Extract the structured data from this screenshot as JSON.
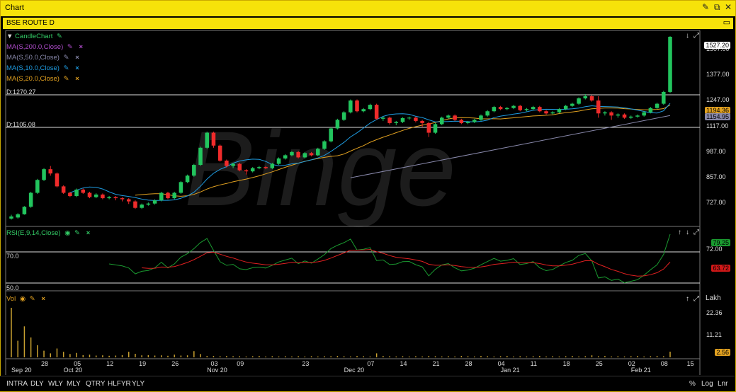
{
  "window": {
    "title": "Chart"
  },
  "panel": {
    "title": "BSE ROUTE D"
  },
  "watermark": "Binge",
  "indicators": [
    {
      "label": "CandleChart",
      "color": "#33cc66"
    },
    {
      "label": "MA(S,200.0,Close)",
      "color": "#b04ccc"
    },
    {
      "label": "MA(S,50.0,Close)",
      "color": "#8888aa"
    },
    {
      "label": "MA(S,10.0,Close)",
      "color": "#1e9be0"
    },
    {
      "label": "MA(S,20.0,Close)",
      "color": "#e0a020"
    }
  ],
  "hlines": {
    "upper_label": "D:1270.27",
    "lower_label": "D:1105.08"
  },
  "price_axis": {
    "ticks": [
      "1507.00",
      "1377.00",
      "1247.00",
      "1117.00",
      "987.00",
      "857.00",
      "727.00"
    ],
    "last_price": "1527.20",
    "ma_a": "1194.36",
    "ma_b": "1154.95"
  },
  "rsi": {
    "label": "RSI(E,9,14,Close)",
    "level_high": "70.0",
    "level_low": "50.0",
    "axis_tick": "72.00",
    "value_a": "79.25",
    "value_b": "63.72"
  },
  "volume": {
    "label": "Vol",
    "unit": "Lakh",
    "ticks": [
      "22.36",
      "11.21"
    ],
    "last": "2.56"
  },
  "date_axis": [
    {
      "d": "Sep 20",
      "p": 0
    },
    {
      "d": "28",
      "p": 5
    },
    {
      "d": "Oct 20",
      "p": 8
    },
    {
      "d": "05",
      "p": 10
    },
    {
      "d": "12",
      "p": 15
    },
    {
      "d": "19",
      "p": 20
    },
    {
      "d": "26",
      "p": 25
    },
    {
      "d": "Nov 20",
      "p": 30
    },
    {
      "d": "03",
      "p": 31
    },
    {
      "d": "09",
      "p": 35
    },
    {
      "d": "23",
      "p": 45
    },
    {
      "d": "Dec 20",
      "p": 51
    },
    {
      "d": "07",
      "p": 55
    },
    {
      "d": "14",
      "p": 60
    },
    {
      "d": "21",
      "p": 65
    },
    {
      "d": "28",
      "p": 70
    },
    {
      "d": "04",
      "p": 75
    },
    {
      "d": "Jan 21",
      "p": 75
    },
    {
      "d": "11",
      "p": 80
    },
    {
      "d": "18",
      "p": 85
    },
    {
      "d": "25",
      "p": 90
    },
    {
      "d": "02",
      "p": 95
    },
    {
      "d": "Feb 21",
      "p": 95
    },
    {
      "d": "08",
      "p": 100
    },
    {
      "d": "15",
      "p": 104
    }
  ],
  "timeframes": [
    "INTRA",
    "DLY",
    "WLY",
    "MLY",
    "QTRY",
    "HLFYR",
    "YLY"
  ],
  "right_buttons": [
    "%",
    "Log",
    "Lnr"
  ],
  "candles": [
    [
      680,
      690,
      675,
      698
    ],
    [
      685,
      700,
      680,
      705
    ],
    [
      700,
      735,
      698,
      738
    ],
    [
      735,
      800,
      730,
      805
    ],
    [
      800,
      860,
      795,
      865
    ],
    [
      860,
      910,
      855,
      915
    ],
    [
      910,
      890,
      880,
      925
    ],
    [
      890,
      830,
      825,
      895
    ],
    [
      830,
      800,
      795,
      835
    ],
    [
      800,
      785,
      780,
      805
    ],
    [
      785,
      815,
      780,
      820
    ],
    [
      815,
      800,
      795,
      820
    ],
    [
      800,
      780,
      775,
      805
    ],
    [
      780,
      792,
      775,
      798
    ],
    [
      792,
      775,
      770,
      797
    ],
    [
      775,
      780,
      770,
      785
    ],
    [
      780,
      775,
      765,
      785
    ],
    [
      775,
      770,
      760,
      780
    ],
    [
      770,
      760,
      748,
      775
    ],
    [
      760,
      730,
      725,
      765
    ],
    [
      730,
      745,
      725,
      750
    ],
    [
      745,
      750,
      740,
      755
    ],
    [
      750,
      765,
      745,
      770
    ],
    [
      765,
      800,
      760,
      805
    ],
    [
      800,
      775,
      770,
      805
    ],
    [
      775,
      800,
      770,
      805
    ],
    [
      800,
      850,
      795,
      855
    ],
    [
      850,
      880,
      845,
      885
    ],
    [
      880,
      930,
      875,
      935
    ],
    [
      930,
      1010,
      925,
      1015
    ],
    [
      1010,
      1080,
      1005,
      1085
    ],
    [
      1080,
      1020,
      1010,
      1085
    ],
    [
      1020,
      950,
      945,
      1025
    ],
    [
      950,
      925,
      918,
      955
    ],
    [
      925,
      935,
      915,
      940
    ],
    [
      935,
      905,
      900,
      940
    ],
    [
      905,
      900,
      885,
      910
    ],
    [
      900,
      915,
      895,
      920
    ],
    [
      915,
      920,
      910,
      925
    ],
    [
      920,
      915,
      910,
      925
    ],
    [
      915,
      935,
      910,
      940
    ],
    [
      935,
      960,
      930,
      965
    ],
    [
      960,
      975,
      955,
      980
    ],
    [
      975,
      990,
      970,
      995
    ],
    [
      990,
      965,
      960,
      995
    ],
    [
      965,
      985,
      960,
      990
    ],
    [
      985,
      975,
      970,
      990
    ],
    [
      975,
      1005,
      970,
      1010
    ],
    [
      1005,
      1040,
      1000,
      1045
    ],
    [
      1040,
      1100,
      1035,
      1105
    ],
    [
      1100,
      1140,
      1095,
      1145
    ],
    [
      1140,
      1175,
      1135,
      1180
    ],
    [
      1175,
      1230,
      1170,
      1235
    ],
    [
      1230,
      1180,
      1175,
      1235
    ],
    [
      1180,
      1190,
      1175,
      1195
    ],
    [
      1190,
      1210,
      1185,
      1215
    ],
    [
      1210,
      1145,
      1140,
      1215
    ],
    [
      1145,
      1150,
      1135,
      1155
    ],
    [
      1150,
      1125,
      1118,
      1155
    ],
    [
      1125,
      1130,
      1115,
      1135
    ],
    [
      1130,
      1148,
      1125,
      1152
    ],
    [
      1148,
      1150,
      1140,
      1155
    ],
    [
      1150,
      1135,
      1128,
      1155
    ],
    [
      1135,
      1125,
      1105,
      1140
    ],
    [
      1125,
      1080,
      1060,
      1130
    ],
    [
      1080,
      1120,
      1075,
      1125
    ],
    [
      1120,
      1150,
      1115,
      1155
    ],
    [
      1150,
      1160,
      1145,
      1165
    ],
    [
      1160,
      1140,
      1135,
      1165
    ],
    [
      1140,
      1125,
      1120,
      1145
    ],
    [
      1125,
      1130,
      1120,
      1135
    ],
    [
      1130,
      1140,
      1125,
      1145
    ],
    [
      1140,
      1160,
      1135,
      1165
    ],
    [
      1160,
      1180,
      1155,
      1185
    ],
    [
      1180,
      1200,
      1175,
      1205
    ],
    [
      1200,
      1190,
      1185,
      1205
    ],
    [
      1190,
      1195,
      1185,
      1200
    ],
    [
      1195,
      1205,
      1190,
      1210
    ],
    [
      1205,
      1185,
      1180,
      1210
    ],
    [
      1185,
      1190,
      1180,
      1195
    ],
    [
      1190,
      1200,
      1185,
      1205
    ],
    [
      1200,
      1180,
      1175,
      1205
    ],
    [
      1180,
      1170,
      1165,
      1185
    ],
    [
      1170,
      1175,
      1165,
      1180
    ],
    [
      1175,
      1190,
      1170,
      1195
    ],
    [
      1190,
      1205,
      1185,
      1210
    ],
    [
      1205,
      1215,
      1200,
      1220
    ],
    [
      1215,
      1240,
      1210,
      1245
    ],
    [
      1240,
      1250,
      1235,
      1260
    ],
    [
      1250,
      1230,
      1225,
      1255
    ],
    [
      1230,
      1170,
      1150,
      1250
    ],
    [
      1170,
      1175,
      1160,
      1180
    ],
    [
      1175,
      1160,
      1140,
      1180
    ],
    [
      1160,
      1165,
      1150,
      1170
    ],
    [
      1165,
      1150,
      1145,
      1170
    ],
    [
      1150,
      1155,
      1145,
      1160
    ],
    [
      1155,
      1160,
      1150,
      1165
    ],
    [
      1160,
      1175,
      1155,
      1180
    ],
    [
      1175,
      1195,
      1170,
      1200
    ],
    [
      1195,
      1215,
      1190,
      1220
    ],
    [
      1215,
      1270,
      1210,
      1275
    ],
    [
      1270,
      1527,
      1265,
      1530
    ]
  ],
  "volumes": [
    22.4,
    7.5,
    14.0,
    9.0,
    5.5,
    3.0,
    1.8,
    4.0,
    2.5,
    1.5,
    2.0,
    1.0,
    1.2,
    0.8,
    0.9,
    0.7,
    0.8,
    1.0,
    2.5,
    1.6,
    0.9,
    1.0,
    0.8,
    0.9,
    0.7,
    1.2,
    0.8,
    0.9,
    2.8,
    1.5,
    0.6,
    0.6,
    0.5,
    0.6,
    0.5,
    0.5,
    0.4,
    0.5,
    0.6,
    0.4,
    0.5,
    0.4,
    0.5,
    0.4,
    0.5,
    0.4,
    0.5,
    0.4,
    0.5,
    0.5,
    0.6,
    0.5,
    0.4,
    0.6,
    0.5,
    0.4,
    1.8,
    0.6,
    0.5,
    0.4,
    0.5,
    0.4,
    0.5,
    0.4,
    0.6,
    0.5,
    0.4,
    0.5,
    0.4,
    0.6,
    0.5,
    0.4,
    0.6,
    0.5,
    0.4,
    0.5,
    0.6,
    0.4,
    0.5,
    0.4,
    0.5,
    0.6,
    0.4,
    0.5,
    0.4,
    0.5,
    0.6,
    0.4,
    0.5,
    0.9,
    0.5,
    0.6,
    0.4,
    0.5,
    0.4,
    0.5,
    0.6,
    0.4,
    0.5,
    0.6,
    0.5,
    2.56
  ]
}
